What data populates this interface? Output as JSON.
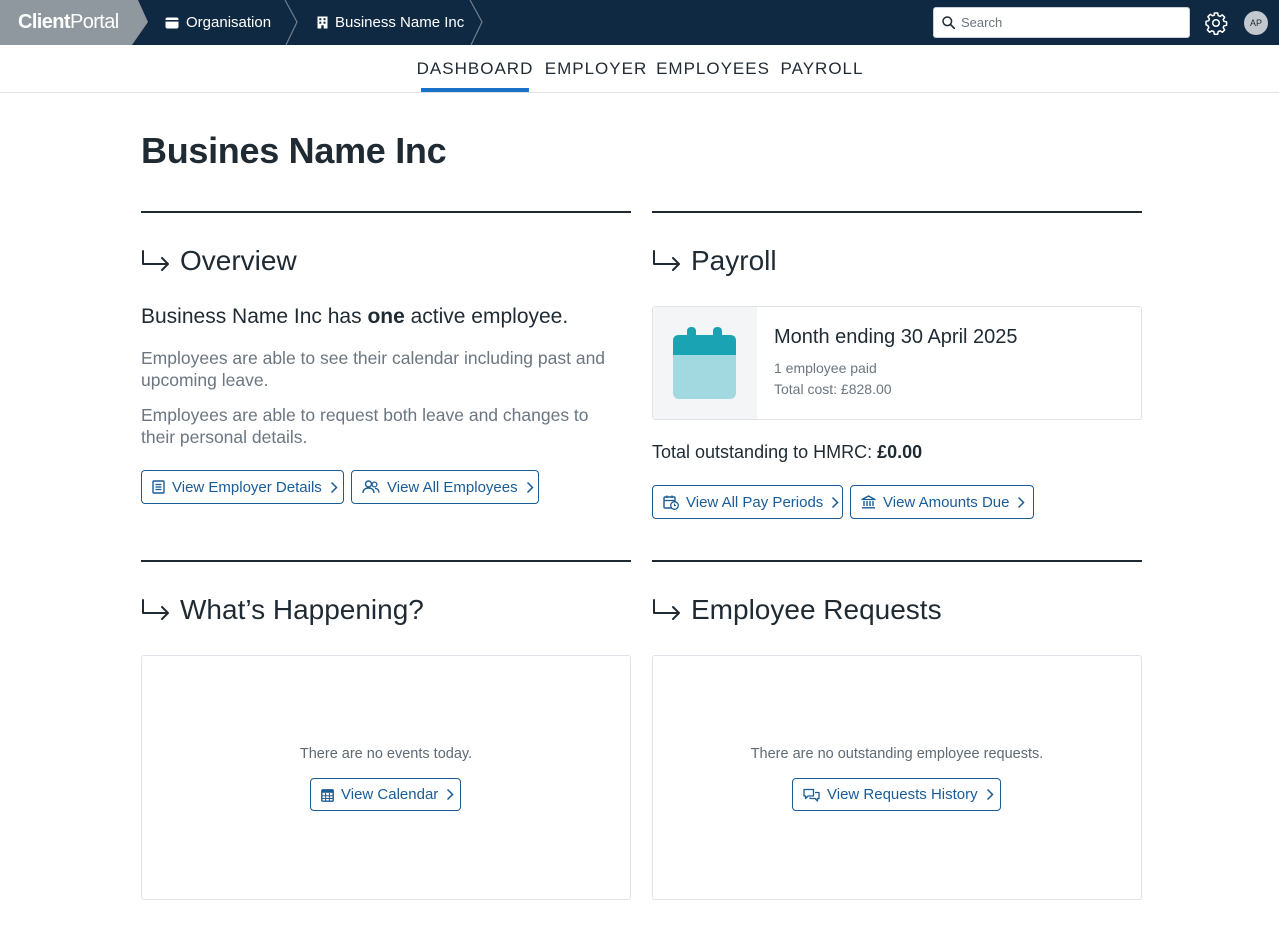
{
  "app": {
    "logo_bold": "Client",
    "logo_light": "Portal",
    "breadcrumbs": [
      {
        "label": "Organisation",
        "icon": "wallet-icon"
      },
      {
        "label": "Business Name Inc",
        "icon": "building-icon"
      }
    ],
    "search_placeholder": "Search",
    "avatar_initials": "AP"
  },
  "nav": {
    "tabs": [
      {
        "label": "DASHBOARD",
        "active": true
      },
      {
        "label": "EMPLOYER",
        "active": false
      },
      {
        "label": "EMPLOYEES",
        "active": false
      },
      {
        "label": "PAYROLL",
        "active": false
      }
    ]
  },
  "page": {
    "title": "Busines Name Inc"
  },
  "overview": {
    "heading": "Overview",
    "lead_prefix": "Business Name Inc has ",
    "lead_bold": "one",
    "lead_suffix": " active employee.",
    "para1": "Employees are able to see their calendar including past and upcoming leave.",
    "para2": "Employees are able to request both leave and changes to their personal details.",
    "btn_employer": "View Employer Details",
    "btn_employees": "View All Employees"
  },
  "payroll": {
    "heading": "Payroll",
    "month": "Month ending 30 April 2025",
    "paid": "1 employee paid",
    "total_cost": "Total cost: £828.00",
    "outstanding_label": "Total outstanding to HMRC: ",
    "outstanding_value": "£0.00",
    "btn_periods": "View All Pay Periods",
    "btn_amounts": "View Amounts Due"
  },
  "happening": {
    "heading": "What’s Happening?",
    "message": "There are no events today.",
    "btn_calendar": "View Calendar"
  },
  "requests": {
    "heading": "Employee Requests",
    "message": "There are no outstanding employee requests.",
    "btn_history": "View Requests History"
  },
  "colors": {
    "topbar": "#0f2942",
    "accent": "#1a73c8",
    "button_text": "#1a5c96",
    "calendar_dark": "#1aa3b3",
    "calendar_light": "#a2d9e0"
  }
}
